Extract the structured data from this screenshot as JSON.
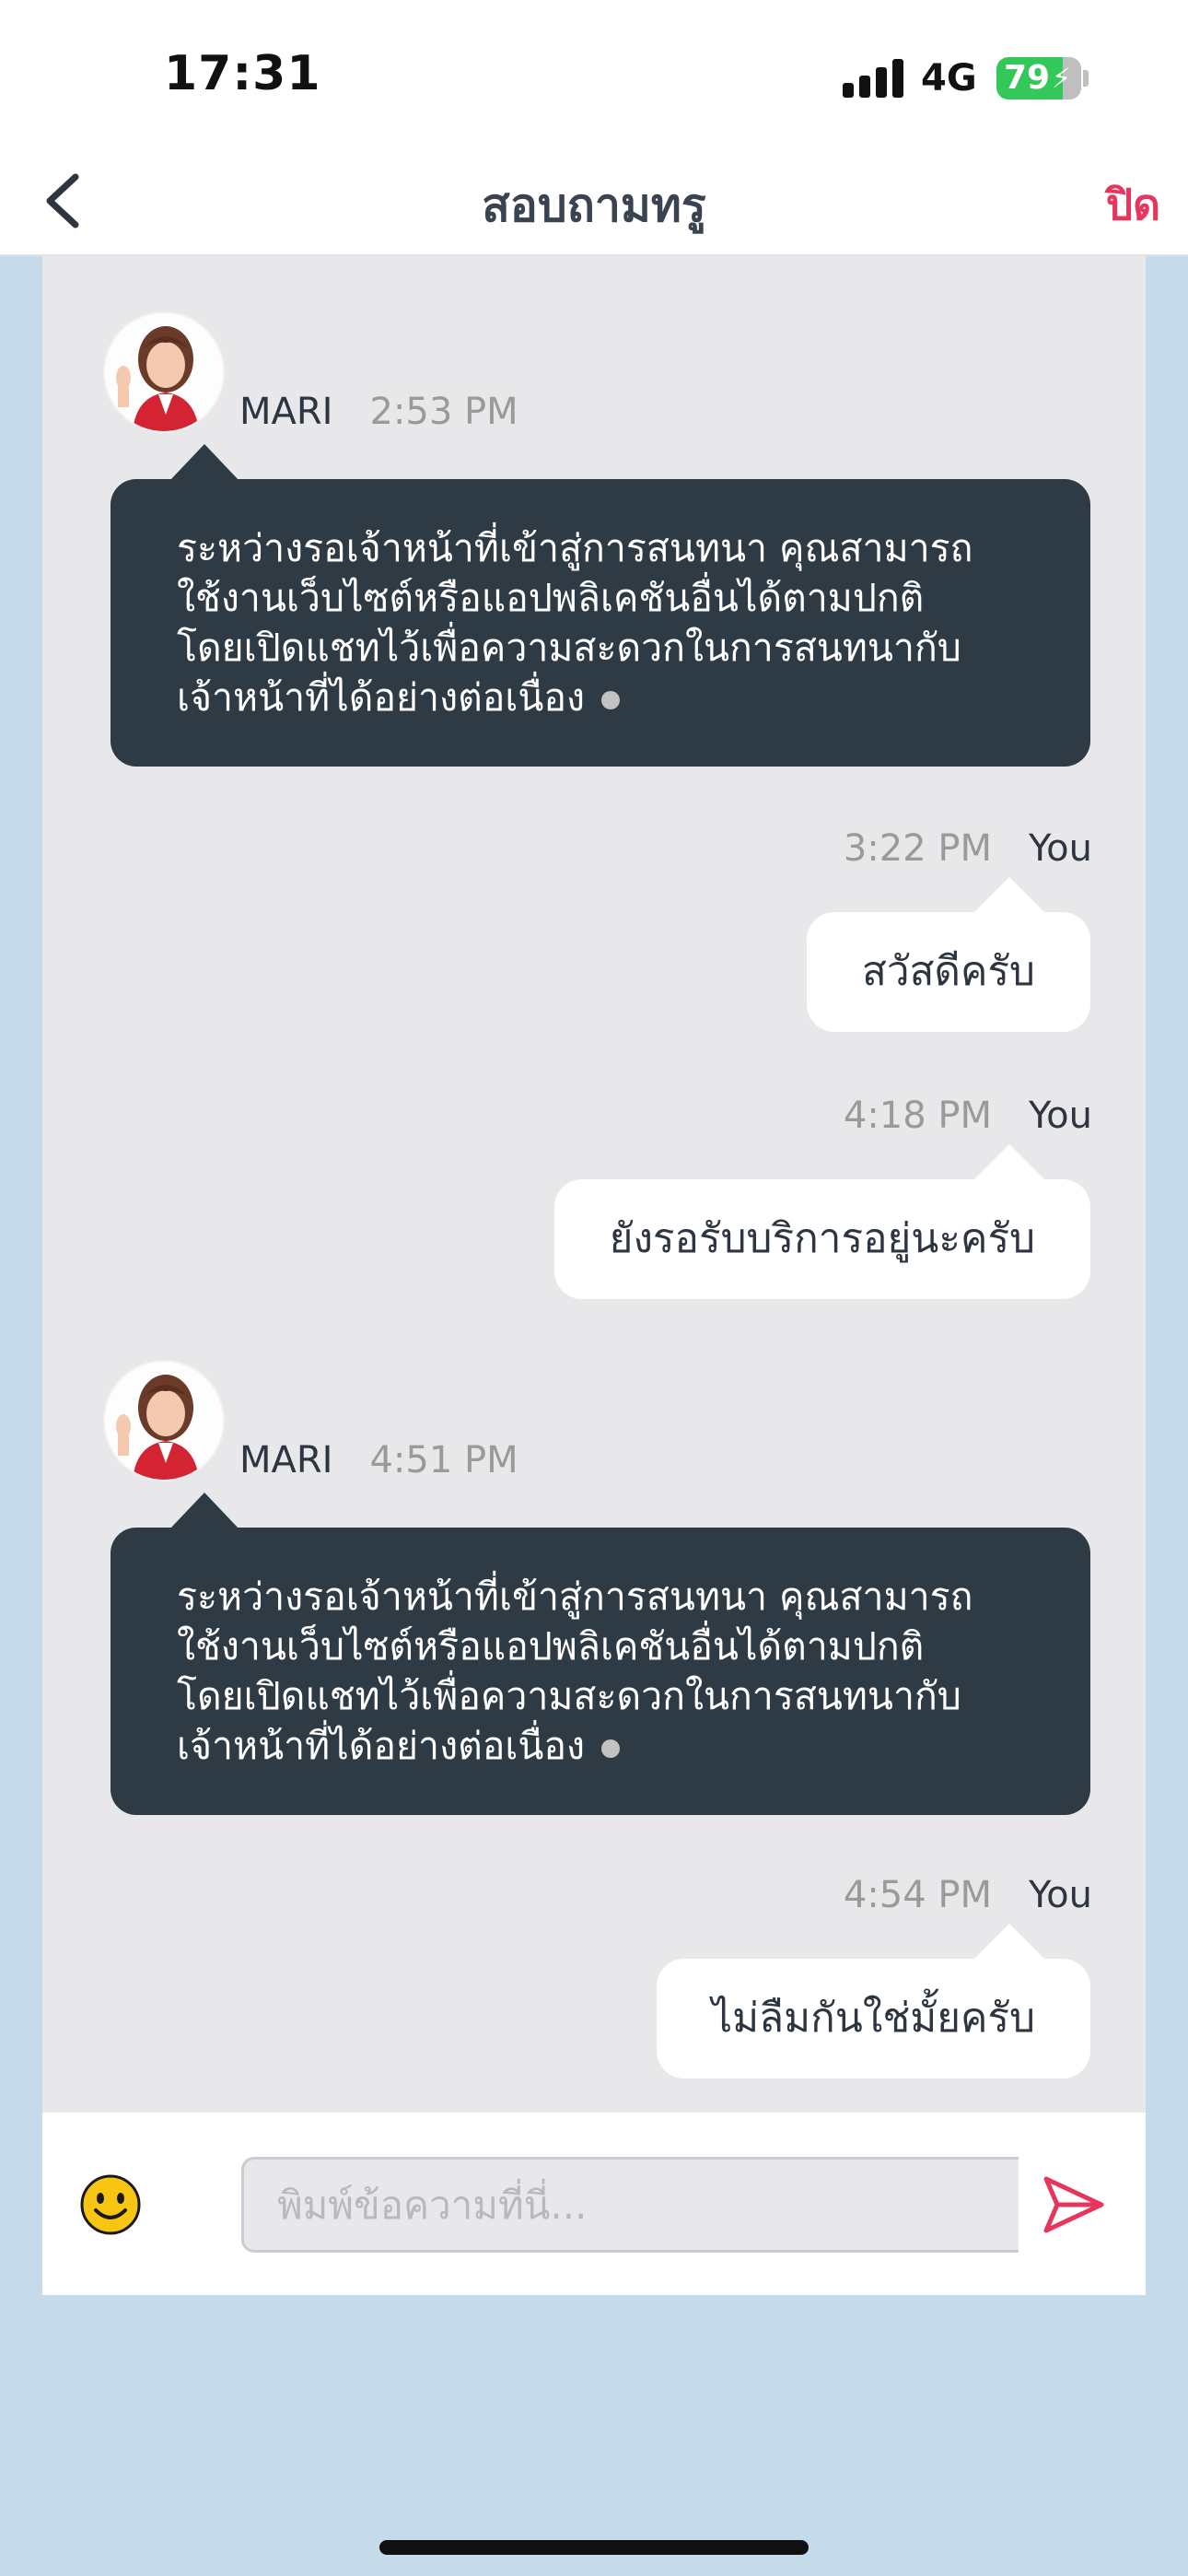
{
  "status_bar": {
    "time": "17:31",
    "network": "4G",
    "battery_level": 79,
    "battery_text": "79",
    "signal_bars": 4
  },
  "nav": {
    "title": "สอบถามทรู",
    "close_label": "ปิด",
    "back_icon": "chevron-left-icon"
  },
  "messages": [
    {
      "sender": "MARI",
      "time": "2:53 PM",
      "lines": [
        "ระหว่างรอเจ้าหน้าที่เข้าสู่การสนทนา คุณสามารถ",
        "ใช้งานเว็บไซต์หรือแอปพลิเคชันอื่นได้ตามปกติ",
        "โดยเปิดแชทไว้เพื่อความสะดวกในการสนทนากับ",
        "เจ้าหน้าที่ได้อย่างต่อเนื่อง"
      ]
    },
    {
      "sender": "You",
      "time": "3:22 PM",
      "text": "สวัสดีครับ"
    },
    {
      "sender": "You",
      "time": "4:18 PM",
      "text": "ยังรอรับบริการอยู่นะครับ"
    },
    {
      "sender": "MARI",
      "time": "4:51 PM",
      "lines": [
        "ระหว่างรอเจ้าหน้าที่เข้าสู่การสนทนา คุณสามารถ",
        "ใช้งานเว็บไซต์หรือแอปพลิเคชันอื่นได้ตามปกติ",
        "โดยเปิดแชทไว้เพื่อความสะดวกในการสนทนากับ",
        "เจ้าหน้าที่ได้อย่างต่อเนื่อง"
      ]
    },
    {
      "sender": "You",
      "time": "4:54 PM",
      "text": "ไม่ลืมกันใช่มั้ยครับ"
    }
  ],
  "composer": {
    "placeholder": "พิมพ์ข้อความที่นี่...",
    "value": "",
    "emoji_icon": "smiley-icon",
    "send_icon": "send-icon"
  },
  "colors": {
    "accent": "#e8355e",
    "agent_bubble": "#2e3a44",
    "chat_bg": "#e8e8ea",
    "page_bg": "#c5dbe9"
  }
}
